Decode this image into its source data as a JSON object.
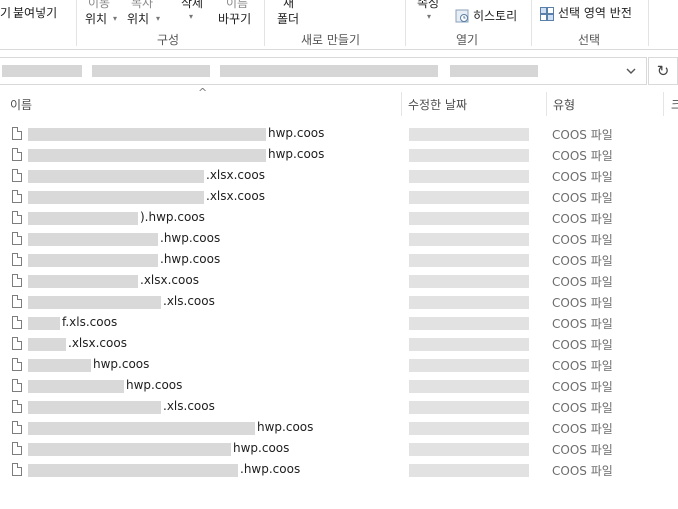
{
  "ribbon": {
    "paste_label": "붙여넣기",
    "paste_prefix": "기",
    "move_label_top": "이동",
    "move_label": "위치",
    "copy_label_top": "복사",
    "copy_label": "위치",
    "delete_label": "삭제",
    "rename_label_top": "이름",
    "rename_label": "바꾸기",
    "new_label_top": "새",
    "new_label": "폴더",
    "props_label": "속성",
    "history_label": "히스토리",
    "select_inverse_label": "선택 영역 반전",
    "group_organize": "구성",
    "group_new": "새로 만들기",
    "group_open": "열기",
    "group_select": "선택"
  },
  "address": {
    "refresh_icon": "refresh-icon",
    "dropdown_icon": "chevron-down-icon"
  },
  "columns": {
    "name": "이름",
    "modified": "수정한 날짜",
    "type": "유형",
    "size": "크"
  },
  "files": [
    {
      "suffix": "hwp.coos",
      "type": "COOS 파일"
    },
    {
      "suffix": "hwp.coos",
      "type": "COOS 파일"
    },
    {
      "suffix": ".xlsx.coos",
      "type": "COOS 파일"
    },
    {
      "suffix": ".xlsx.coos",
      "type": "COOS 파일"
    },
    {
      "suffix": ").hwp.coos",
      "type": "COOS 파일"
    },
    {
      "suffix": ".hwp.coos",
      "type": "COOS 파일"
    },
    {
      "suffix": ".hwp.coos",
      "type": "COOS 파일"
    },
    {
      "suffix": ".xlsx.coos",
      "type": "COOS 파일"
    },
    {
      "suffix": ".xls.coos",
      "type": "COOS 파일"
    },
    {
      "suffix": "f.xls.coos",
      "type": "COOS 파일"
    },
    {
      "suffix": ".xlsx.coos",
      "type": "COOS 파일"
    },
    {
      "suffix": "hwp.coos",
      "type": "COOS 파일"
    },
    {
      "suffix": "hwp.coos",
      "type": "COOS 파일"
    },
    {
      "suffix": ".xls.coos",
      "type": "COOS 파일"
    },
    {
      "suffix": "hwp.coos",
      "type": "COOS 파일"
    },
    {
      "suffix": "hwp.coos",
      "type": "COOS 파일"
    },
    {
      "suffix": ".hwp.coos",
      "type": "COOS 파일"
    }
  ]
}
